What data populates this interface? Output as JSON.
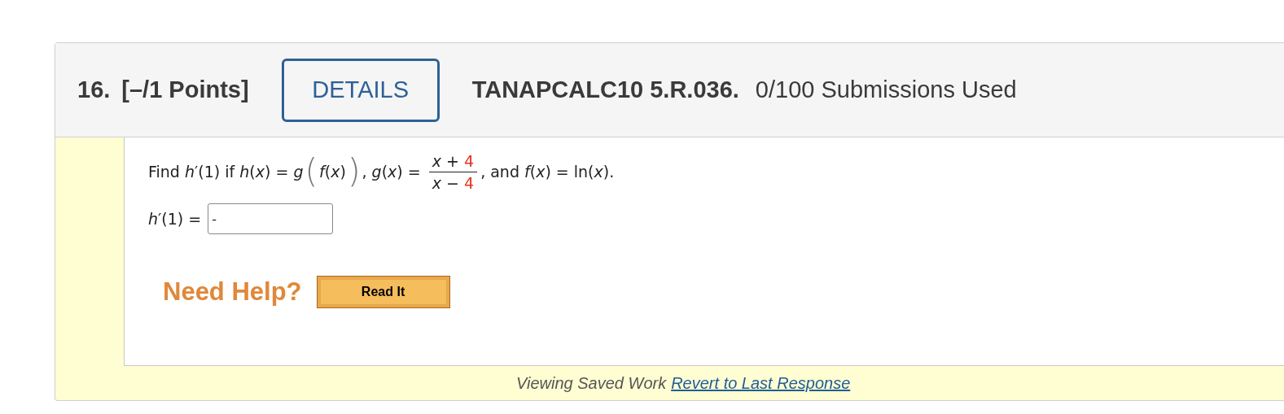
{
  "header": {
    "number": "16.",
    "points": "[–/1 Points]",
    "details_button": "DETAILS",
    "problem_id": "TANAPCALC10 5.R.036.",
    "submissions": "0/100 Submissions Used"
  },
  "question": {
    "lead": "Find *h*′(1) if *h*(*x*) = *g*",
    "open_paren": "(",
    "inner": "*f*(*x*)",
    "close_paren": ")",
    "middle": ", *g*(*x*) =",
    "fraction": {
      "numerator": {
        "term": "*x* +",
        "constant": "4"
      },
      "denominator": {
        "term": "*x* −",
        "constant": "4"
      }
    },
    "tail": ", and *f*(*x*) = ln(*x*)."
  },
  "answer": {
    "label": "*h*′(1) =",
    "value": "-"
  },
  "help": {
    "label": "Need Help?",
    "buttons": [
      "Read It"
    ]
  },
  "footer": {
    "status": "Viewing Saved Work",
    "link": "Revert to Last Response"
  }
}
